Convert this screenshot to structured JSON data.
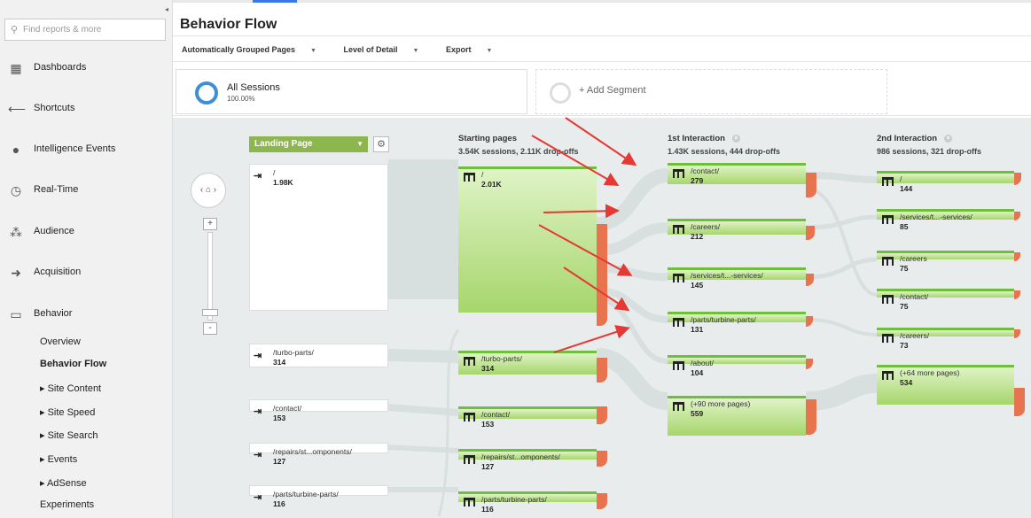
{
  "search": {
    "placeholder": "Find reports & more"
  },
  "nav": {
    "dashboards": "Dashboards",
    "shortcuts": "Shortcuts",
    "intelligence": "Intelligence Events",
    "realtime": "Real-Time",
    "audience": "Audience",
    "acquisition": "Acquisition",
    "behavior": "Behavior",
    "sub": {
      "overview": "Overview",
      "behavior_flow": "Behavior Flow",
      "site_content": "▸ Site Content",
      "site_speed": "▸ Site Speed",
      "site_search": "▸ Site Search",
      "events": "▸ Events",
      "adsense": "▸ AdSense",
      "experiments": "Experiments"
    }
  },
  "page": {
    "title": "Behavior Flow"
  },
  "toolbar": {
    "grouped": "Automatically Grouped Pages",
    "level": "Level of Detail",
    "export": "Export"
  },
  "segments": {
    "all_name": "All Sessions",
    "all_pct": "100.00%",
    "add": "+ Add Segment"
  },
  "flow": {
    "landing_dropdown": "Landing Page",
    "columns": {
      "starting": {
        "title": "Starting pages",
        "sub": "3.54K sessions, 2.11K drop-offs"
      },
      "first": {
        "title": "1st Interaction",
        "sub": "1.43K sessions, 444 drop-offs"
      },
      "second": {
        "title": "2nd Interaction",
        "sub": "986 sessions, 321 drop-offs"
      }
    },
    "landing": [
      {
        "name": "/",
        "count": "1.98K"
      },
      {
        "name": "/turbo-parts/",
        "count": "314"
      },
      {
        "name": "/contact/",
        "count": "153"
      },
      {
        "name": "/repairs/st...omponents/",
        "count": "127"
      },
      {
        "name": "/parts/turbine-parts/",
        "count": "116"
      }
    ],
    "starting": [
      {
        "name": "/",
        "count": "2.01K"
      },
      {
        "name": "/turbo-parts/",
        "count": "314"
      },
      {
        "name": "/contact/",
        "count": "153"
      },
      {
        "name": "/repairs/st...omponents/",
        "count": "127"
      },
      {
        "name": "/parts/turbine-parts/",
        "count": "116"
      }
    ],
    "first": [
      {
        "name": "/contact/",
        "count": "279"
      },
      {
        "name": "/careers/",
        "count": "212"
      },
      {
        "name": "/services/t...-services/",
        "count": "145"
      },
      {
        "name": "/parts/turbine-parts/",
        "count": "131"
      },
      {
        "name": "/about/",
        "count": "104"
      },
      {
        "name": "(+90 more pages)",
        "count": "559"
      }
    ],
    "second": [
      {
        "name": "/",
        "count": "144"
      },
      {
        "name": "/services/t...-services/",
        "count": "85"
      },
      {
        "name": "/careers",
        "count": "75"
      },
      {
        "name": "/contact/",
        "count": "75"
      },
      {
        "name": "/careers/",
        "count": "73"
      },
      {
        "name": "(+64 more pages)",
        "count": "534"
      }
    ]
  },
  "colors": {
    "accent": "#8db74e",
    "dropoff": "#e8734f",
    "annotation": "#e53935"
  }
}
